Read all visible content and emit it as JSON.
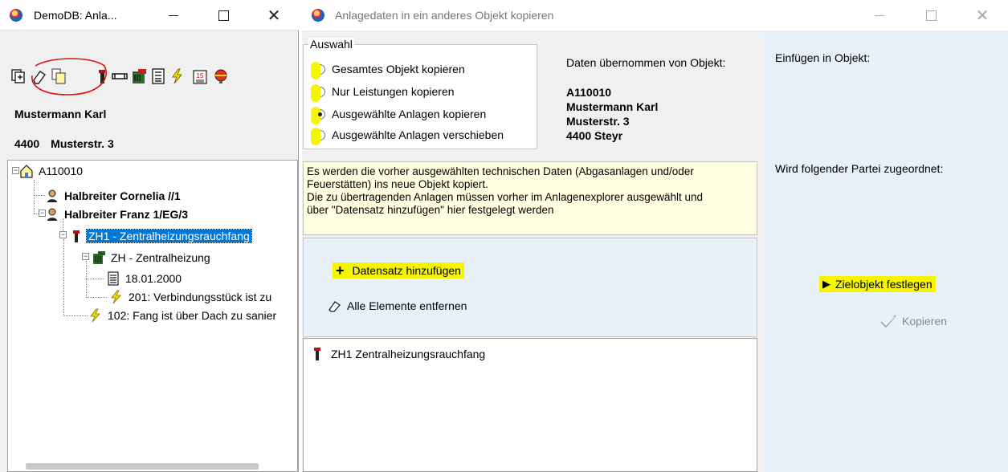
{
  "left_window": {
    "title": "DemoDB: Anla...",
    "toolbar_icons": [
      "copy-object-icon",
      "eraser-icon",
      "copy-data-icon",
      "chimney-icon",
      "pipe-icon",
      "heating-icon",
      "calculator-icon",
      "lightning-icon",
      "calendar-icon",
      "globe-icon"
    ],
    "party_name": "Mustermann Karl",
    "party_zip": "4400",
    "party_street": "Musterstr. 3",
    "tree": [
      {
        "label": "A110010",
        "icon": "house-icon",
        "bold": false
      },
      {
        "label": "Halbreiter Cornelia //1",
        "icon": "person-icon",
        "bold": true
      },
      {
        "label": "Halbreiter Franz 1/EG/3",
        "icon": "person-icon",
        "bold": true
      },
      {
        "label": "ZH1 - Zentralheizungsrauchfang",
        "icon": "chimney-icon",
        "bold": false,
        "selected": true
      },
      {
        "label": "ZH - Zentralheizung",
        "icon": "heating-icon",
        "bold": false
      },
      {
        "label": "18.01.2000",
        "icon": "calculator-icon",
        "bold": false
      },
      {
        "label": "201: Verbindungsstück ist zu",
        "icon": "lightning-icon",
        "bold": false
      },
      {
        "label": "102: Fang ist über Dach zu sanier",
        "icon": "lightning-icon",
        "bold": false
      }
    ]
  },
  "dialog": {
    "title": "Anlagedaten in ein anderes Objekt kopieren",
    "auswahl": {
      "legend": "Auswahl",
      "options": [
        {
          "label": "Gesamtes Objekt kopieren",
          "checked": false
        },
        {
          "label": "Nur Leistungen kopieren",
          "checked": false
        },
        {
          "label": "Ausgewählte Anlagen kopieren",
          "checked": true
        },
        {
          "label": "Ausgewählte Anlagen verschieben",
          "checked": false
        }
      ]
    },
    "source": {
      "label": "Daten übernommen von Objekt:",
      "lines": [
        "A110010",
        "Mustermann Karl",
        "Musterstr. 3",
        "4400 Steyr"
      ]
    },
    "info_lines": [
      "Es werden die vorher ausgewählten technischen Daten (Abgasanlagen und/oder",
      "Feuerstätten) ins neue Objekt kopiert.",
      "Die zu übertragenden Anlagen müssen vorher im Anlagenexplorer ausgewählt und",
      "über \"Datensatz hinzufügen\" hier festgelegt werden"
    ],
    "add_record_label": "Datensatz hinzufügen",
    "remove_all_label": "Alle Elemente entfernen",
    "list_items": [
      "ZH1 Zentralheizungsrauchfang"
    ],
    "insert_into_label": "Einfügen in Objekt:",
    "assign_party_label": "Wird folgender Partei zugeordnet:",
    "target_label": "Zielobjekt festlegen",
    "copy_label": "Kopieren"
  },
  "colors": {
    "highlight": "#f5f500",
    "selection": "#0078d7",
    "info_bg": "#ffffe1",
    "panel_bg": "#e8f0f8",
    "annotation_red": "#e01010"
  }
}
